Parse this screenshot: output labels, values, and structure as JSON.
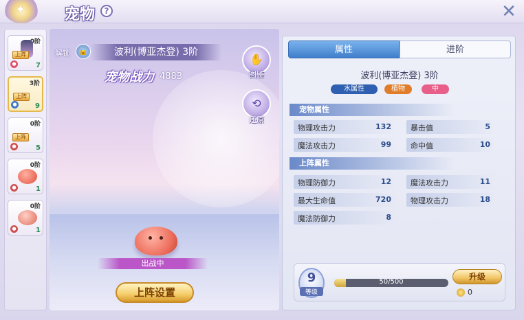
{
  "header": {
    "title": "宠物",
    "help_icon": "question-circle-icon",
    "close_icon": "close-x-icon"
  },
  "pet_list": [
    {
      "rank": "0阶",
      "tag": "上阵",
      "level": "7",
      "element_color": "#e0506a",
      "active": false
    },
    {
      "rank": "3阶",
      "tag": "上阵",
      "level": "9",
      "element_color": "#3c78c8",
      "active": true
    },
    {
      "rank": "0阶",
      "tag": "上阵",
      "level": "5",
      "element_color": "#d05050",
      "active": false
    },
    {
      "rank": "0阶",
      "tag": "",
      "level": "1",
      "element_color": "#d05050",
      "active": false
    },
    {
      "rank": "0阶",
      "tag": "",
      "level": "1",
      "element_color": "#d05050",
      "active": false
    }
  ],
  "display": {
    "unlock_label": "解锁",
    "pet_name": "波利(博亚杰登) 3阶",
    "power_label": "宠物战力",
    "power_value": "4883",
    "codex_label": "图鉴",
    "restore_label": "还原",
    "battle_status": "出战中",
    "deploy_button": "上阵设置"
  },
  "tabs": {
    "attributes": "属性",
    "advance": "进阶"
  },
  "pet_info": {
    "name": "波利(博亚杰登) 3阶",
    "element": "水属性",
    "type": "植物",
    "size": "中",
    "element_color": "#2e5fb0",
    "type_color": "#e07d2a",
    "size_color": "#e8608a"
  },
  "pet_attributes": {
    "header": "宠物属性",
    "rows": [
      {
        "left_name": "物理攻击力",
        "left_value": "132",
        "right_name": "暴击值",
        "right_value": "5"
      },
      {
        "left_name": "魔法攻击力",
        "left_value": "99",
        "right_name": "命中值",
        "right_value": "10"
      }
    ]
  },
  "deploy_attributes": {
    "header": "上阵属性",
    "rows": [
      {
        "left_name": "物理防御力",
        "left_value": "12",
        "right_name": "魔法攻击力",
        "right_value": "11"
      },
      {
        "left_name": "最大生命值",
        "left_value": "720",
        "right_name": "物理攻击力",
        "right_value": "18"
      },
      {
        "left_name": "魔法防御力",
        "left_value": "8",
        "right_name": "",
        "right_value": ""
      }
    ]
  },
  "level": {
    "value": "9",
    "label": "等级",
    "exp_text": "50/500",
    "exp_fraction": 0.1,
    "upgrade_button": "升级",
    "coin_value": "0"
  }
}
